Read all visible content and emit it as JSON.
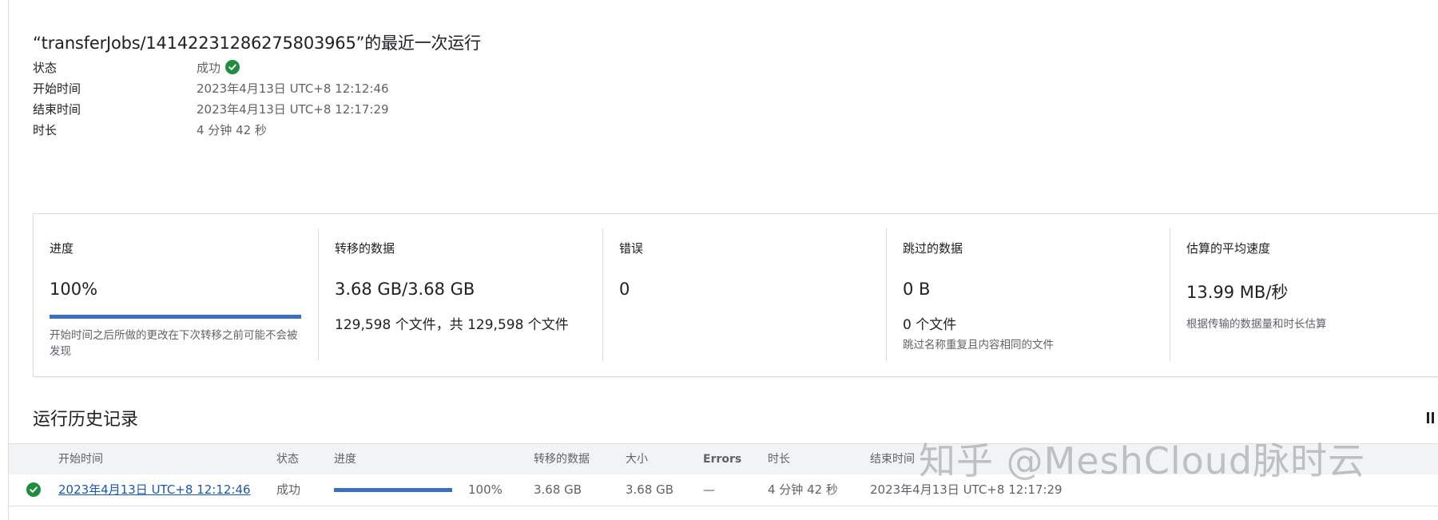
{
  "job": {
    "title": "“transferJobs/14142231286275803965”的最近一次运行",
    "status_label": "状态",
    "status_value": "成功",
    "start_label": "开始时间",
    "start_value": "2023年4月13日 UTC+8 12:12:46",
    "end_label": "结束时间",
    "end_value": "2023年4月13日 UTC+8 12:17:29",
    "duration_label": "时长",
    "duration_value": "4 分钟 42 秒"
  },
  "stats": {
    "progress": {
      "label": "进度",
      "value": "100%",
      "fraction": 1.0,
      "note": "开始时间之后所做的更改在下次转移之前可能不会被发现"
    },
    "transferred": {
      "label": "转移的数据",
      "value": "3.68 GB/3.68 GB",
      "sub": "129,598 个文件，共 129,598 个文件"
    },
    "errors": {
      "label": "错误",
      "value": "0"
    },
    "skipped": {
      "label": "跳过的数据",
      "value": "0 B",
      "sub": "0 个文件",
      "note": "跳过名称重复且内容相同的文件"
    },
    "speed": {
      "label": "估算的平均速度",
      "value": "13.99 MB/秒",
      "note": "根据传输的数据量和时长估算"
    }
  },
  "history": {
    "title": "运行历史记录",
    "columns": [
      "开始时间",
      "状态",
      "进度",
      "转移的数据",
      "大小",
      "Errors",
      "时长",
      "结束时间"
    ],
    "rows": [
      {
        "start": "2023年4月13日 UTC+8 12:12:46",
        "status": "成功",
        "progress_fraction": 1.0,
        "progress_text": "100%",
        "transferred": "3.68 GB",
        "size": "3.68 GB",
        "errors": "—",
        "duration": "4 分钟 42 秒",
        "end": "2023年4月13日 UTC+8 12:17:29"
      }
    ]
  },
  "icons": {
    "status_ok": "check-circle-icon",
    "columns": "column-display-icon"
  },
  "colors": {
    "success": "#1e8e3e",
    "progress": "#3c6fc1",
    "link": "#1a56b4"
  },
  "watermark": "知乎 @MeshCloud脉时云"
}
